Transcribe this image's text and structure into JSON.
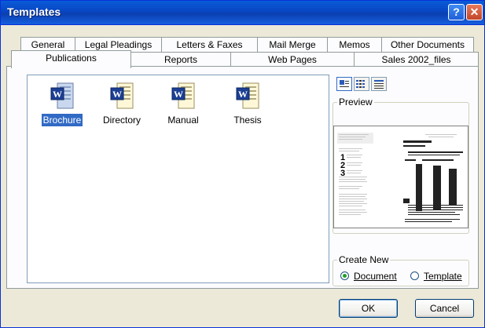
{
  "window": {
    "title": "Templates",
    "help_glyph": "?",
    "close_glyph": "✕"
  },
  "tabs_back": [
    "General",
    "Legal Pleadings",
    "Letters & Faxes",
    "Mail Merge",
    "Memos",
    "Other Documents"
  ],
  "tabs_front": [
    "Publications",
    "Reports",
    "Web Pages",
    "Sales 2002_files"
  ],
  "active_tab": "Publications",
  "files": [
    {
      "label": "Brochure",
      "icon": "word-document-icon",
      "selected": true
    },
    {
      "label": "Directory",
      "icon": "word-document-icon",
      "selected": false
    },
    {
      "label": "Manual",
      "icon": "word-document-icon",
      "selected": false
    },
    {
      "label": "Thesis",
      "icon": "word-document-icon",
      "selected": false
    }
  ],
  "preview": {
    "label": "Preview"
  },
  "create_new": {
    "label": "Create New",
    "document": "Document",
    "template": "Template",
    "selected": "Document"
  },
  "buttons": {
    "ok": "OK",
    "cancel": "Cancel"
  },
  "colors": {
    "titlebar": "#0a5bd8",
    "selection": "#316ac5",
    "face": "#ece9d8"
  }
}
